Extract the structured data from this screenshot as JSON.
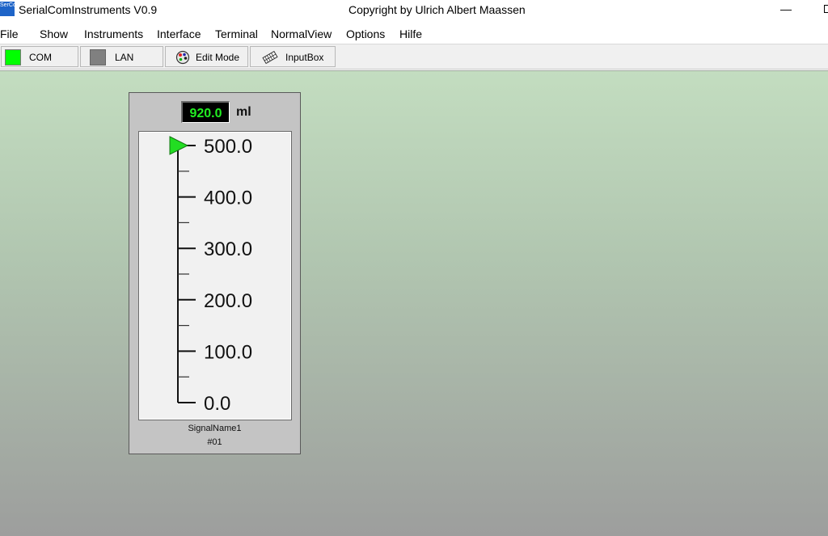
{
  "window": {
    "title": "SerialComInstruments  V0.9",
    "copyright": "Copyright by Ulrich Albert Maassen",
    "icon": "app-logo-icon",
    "icon_text": "SerCo"
  },
  "menu": {
    "items": [
      "File",
      "Show",
      "Instruments",
      "Interface",
      "Terminal",
      "NormalView",
      "Options",
      "Hilfe"
    ]
  },
  "toolbar": {
    "com_label": "COM",
    "com_status_color": "#00ff00",
    "lan_label": "LAN",
    "lan_status_color": "#808080",
    "edit_mode_label": "Edit Mode",
    "inputbox_label": "InputBox"
  },
  "instrument": {
    "value": "920.0",
    "unit": "ml",
    "signal_name": "SignalName1",
    "signal_id": "#01",
    "pointer_color": "#22dd22",
    "scale": {
      "min": 0,
      "max": 500,
      "major_step": 100,
      "minor_step": 50,
      "labels": [
        "500.0",
        "400.0",
        "300.0",
        "200.0",
        "100.0",
        "0.0"
      ],
      "pointer_value": 500
    }
  }
}
